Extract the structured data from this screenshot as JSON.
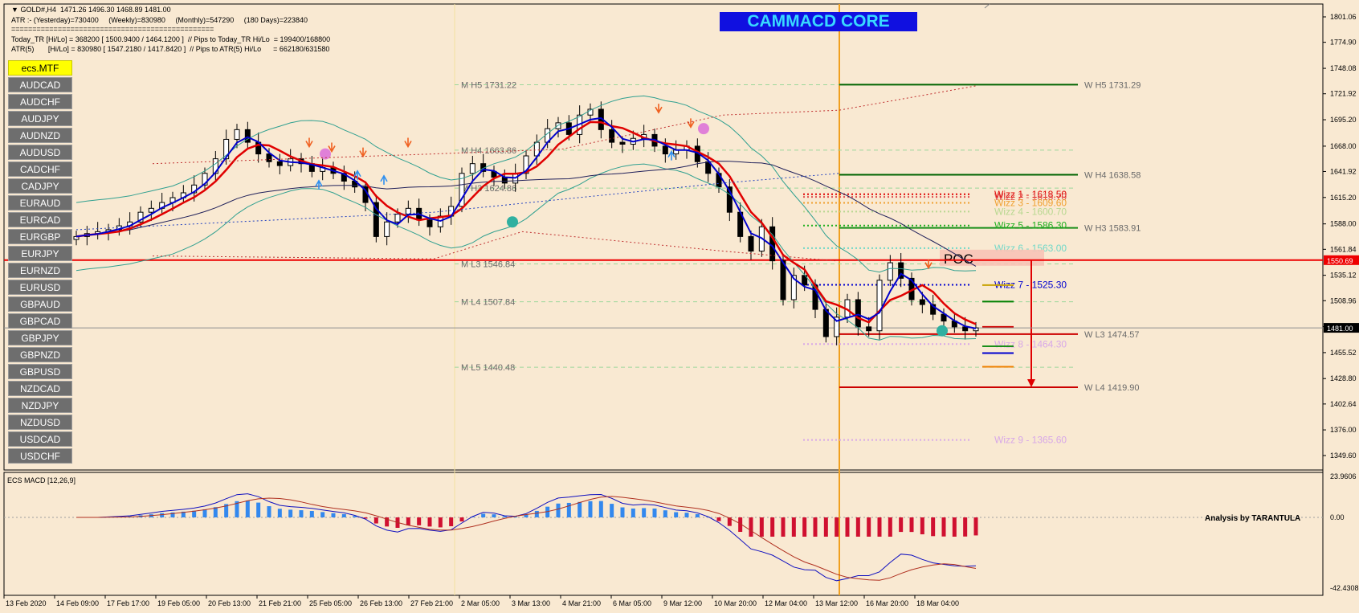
{
  "header": {
    "line1": "GOLD#,H4  1471.26 1496.30 1468.89 1481.00",
    "line2": "ATR :- (Yesterday)=730400     (Weekly)=830980     (Monthly)=547290     (180 Days)=223840",
    "line3": "================================================",
    "line4": "Today_TR [Hi/Lo] = 368200 [ 1500.9400 / 1464.1200 ]  // Pips to Today_TR Hi/Lo  = 199400/168800",
    "line5": "ATR(5)       [Hi/Lo] = 830980 [ 1547.2180 / 1417.8420 ]  // Pips to ATR(5) Hi/Lo      = 662180/631580"
  },
  "title_label": "CAMMACD CORE",
  "symbols": {
    "active": "ecs.MTF",
    "list": [
      "AUDCAD",
      "AUDCHF",
      "AUDJPY",
      "AUDNZD",
      "AUDUSD",
      "CADCHF",
      "CADJPY",
      "EURAUD",
      "EURCAD",
      "EURGBP",
      "EURJPY",
      "EURNZD",
      "EURUSD",
      "GBPAUD",
      "GBPCAD",
      "GBPJPY",
      "GBPNZD",
      "GBPUSD",
      "NZDCAD",
      "NZDJPY",
      "NZDUSD",
      "USDCAD",
      "USDCHF"
    ]
  },
  "price_axis": {
    "labels": [
      "1801.06",
      "1774.90",
      "1748.08",
      "1721.92",
      "1695.20",
      "1668.00",
      "1641.92",
      "1615.20",
      "1588.00",
      "1561.84",
      "1535.12",
      "1508.96",
      "1482.24",
      "1455.52",
      "1428.80",
      "1402.64",
      "1376.00",
      "1349.60"
    ],
    "red_tag": "1550.69",
    "current_tag": "1481.00"
  },
  "time_axis": [
    "13 Feb 2020",
    "14 Feb 09:00",
    "17 Feb 17:00",
    "19 Feb 05:00",
    "20 Feb 13:00",
    "21 Feb 21:00",
    "25 Feb 05:00",
    "26 Feb 13:00",
    "27 Feb 21:00",
    "2 Mar 05:00",
    "3 Mar 13:00",
    "4 Mar 21:00",
    "6 Mar 05:00",
    "9 Mar 12:00",
    "10 Mar 20:00",
    "12 Mar 04:00",
    "13 Mar 12:00",
    "16 Mar 20:00",
    "18 Mar 04:00"
  ],
  "monthly_levels": [
    {
      "label": "M  H5 1731.22",
      "price": 1731.22
    },
    {
      "label": "M  H4 1663.86",
      "price": 1663.86
    },
    {
      "label": "M  H3 1624.86",
      "price": 1624.86
    },
    {
      "label": "M  L3 1546.84",
      "price": 1546.84
    },
    {
      "label": "M  L4 1507.84",
      "price": 1507.84
    },
    {
      "label": "M  L5 1440.48",
      "price": 1440.48
    }
  ],
  "weekly_levels": [
    {
      "label": "W  H5 1731.29",
      "price": 1731.29,
      "color": "#006400"
    },
    {
      "label": "W  H4 1638.58",
      "price": 1638.58,
      "color": "#006400"
    },
    {
      "label": "W  H3 1583.91",
      "price": 1583.91,
      "color": "#1a8f1a"
    },
    {
      "label": "W  L3 1474.57",
      "price": 1474.57,
      "color": "#cc0000"
    },
    {
      "label": "W  L4 1419.90",
      "price": 1419.9,
      "color": "#cc0000"
    }
  ],
  "wizz": [
    {
      "label": "Wizz 1 - 1618.50",
      "price": 1618.5,
      "color": "#e00000"
    },
    {
      "label": "Wizz 2 - 1615.70",
      "price": 1615.7,
      "color": "#e05050"
    },
    {
      "label": "Wizz 3 - 1609.60",
      "price": 1609.6,
      "color": "#f0a030"
    },
    {
      "label": "Wizz 4 - 1600.70",
      "price": 1600.7,
      "color": "#b8d890"
    },
    {
      "label": "Wizz 5 - 1586.30",
      "price": 1586.3,
      "color": "#20b020"
    },
    {
      "label": "Wizz 6 - 1563.00",
      "price": 1563.0,
      "color": "#70d8c8"
    },
    {
      "label": "Wizz 7 - 1525.30",
      "price": 1525.3,
      "color": "#0000d0"
    },
    {
      "label": "Wizz 8 - 1464.30",
      "price": 1464.3,
      "color": "#d8a8e8"
    },
    {
      "label": "Wizz 9 - 1365.60",
      "price": 1365.6,
      "color": "#d8a8e8"
    }
  ],
  "poc_label": "POC",
  "macd": {
    "label": "ECS MACD [12,26,9]",
    "axis": [
      "23.9606",
      "0.00",
      "-42.4308"
    ],
    "credit": "Analysis by TARANTULA"
  },
  "colors": {
    "background": "#f9e9d2",
    "red_line": "#ee0000",
    "blue_ma": "#0000cc",
    "bands": "#30a090",
    "vertical_marker": "#f0a020"
  }
}
